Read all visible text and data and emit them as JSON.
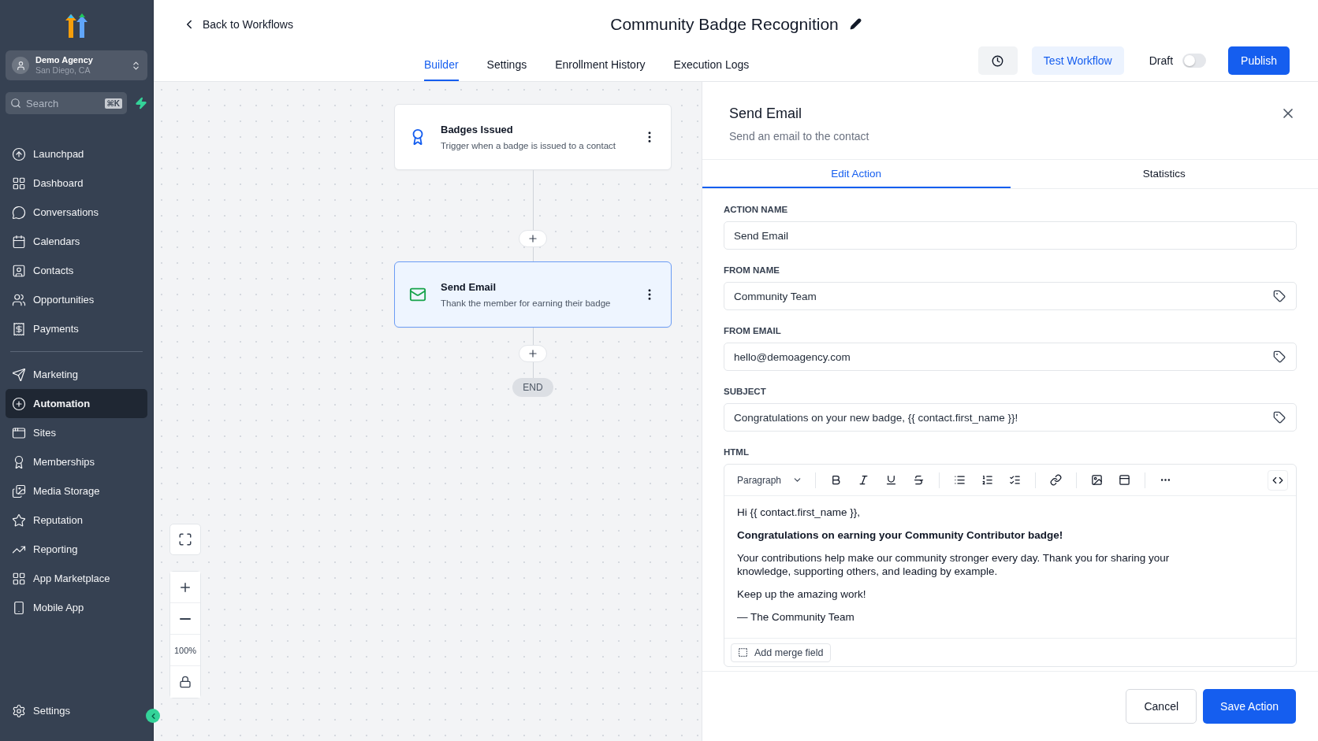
{
  "account": {
    "name": "Demo Agency",
    "location": "San Diego, CA"
  },
  "search": {
    "placeholder": "Search",
    "shortcut": "⌘K"
  },
  "nav": [
    [
      {
        "label": "Launchpad",
        "selected": false
      },
      {
        "label": "Dashboard",
        "selected": false
      },
      {
        "label": "Conversations",
        "selected": false
      },
      {
        "label": "Calendars",
        "selected": false
      },
      {
        "label": "Contacts",
        "selected": false
      },
      {
        "label": "Opportunities",
        "selected": false
      },
      {
        "label": "Payments",
        "selected": false
      }
    ],
    [
      {
        "label": "Marketing",
        "selected": false
      },
      {
        "label": "Automation",
        "selected": true
      },
      {
        "label": "Sites",
        "selected": false
      },
      {
        "label": "Memberships",
        "selected": false
      },
      {
        "label": "Media Storage",
        "selected": false
      },
      {
        "label": "Reputation",
        "selected": false
      },
      {
        "label": "Reporting",
        "selected": false
      },
      {
        "label": "App Marketplace",
        "selected": false
      },
      {
        "label": "Mobile App",
        "selected": false
      }
    ]
  ],
  "nav_footer": {
    "label": "Settings"
  },
  "header": {
    "back": "Back to Workflows",
    "title": "Community Badge Recognition",
    "tabs": [
      {
        "label": "Builder",
        "selected": true
      },
      {
        "label": "Settings",
        "selected": false
      },
      {
        "label": "Enrollment History",
        "selected": false
      },
      {
        "label": "Execution Logs",
        "selected": false
      }
    ],
    "test_button": "Test Workflow",
    "draft": {
      "label": "Draft",
      "on": false
    },
    "publish_button": "Publish"
  },
  "canvas": {
    "nodes": [
      {
        "kind": "trigger",
        "title": "Badges Issued",
        "description": "Trigger when a badge is issued to a contact",
        "selected": false
      },
      {
        "kind": "email",
        "title": "Send Email",
        "description": "Thank the member for earning their badge",
        "selected": true
      }
    ],
    "end": "END",
    "zoom": "100%"
  },
  "panel": {
    "title": "Send Email",
    "subtitle": "Send an email to the contact",
    "tabs": [
      {
        "label": "Edit Action",
        "selected": true
      },
      {
        "label": "Statistics",
        "selected": false
      }
    ],
    "fields": [
      {
        "label": "ACTION NAME",
        "value": "Send Email",
        "tag": false
      },
      {
        "label": "FROM NAME",
        "value": "Community Team",
        "tag": true
      },
      {
        "label": "FROM EMAIL",
        "value": "hello@demoagency.com",
        "tag": true
      },
      {
        "label": "SUBJECT",
        "value": "Congratulations on your new badge, {{ contact.first_name }}!",
        "tag": true
      }
    ],
    "html": {
      "label": "HTML",
      "format": "Paragraph",
      "paragraphs": [
        {
          "text": "Hi {{ contact.first_name }},",
          "bold": false
        },
        {
          "text": "Congratulations on earning your Community Contributor badge!",
          "bold": true
        },
        {
          "text": "Your contributions help make our community stronger every day. Thank you for sharing your knowledge, supporting others, and leading by example.",
          "bold": false
        },
        {
          "text": "Keep up the amazing work!",
          "bold": false
        },
        {
          "text": "— The Community Team",
          "bold": false
        }
      ],
      "merge_button": "Add merge field"
    },
    "cancel_button": "Cancel",
    "save_button": "Save Action"
  }
}
